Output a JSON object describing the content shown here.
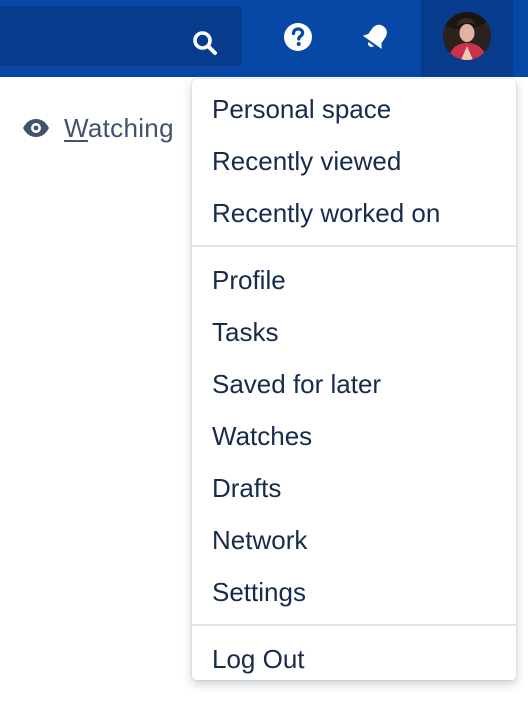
{
  "header": {
    "icons": {
      "search": "search-icon",
      "help": "help-icon",
      "notifications": "bell-icon",
      "avatar": "avatar"
    },
    "colors": {
      "bar": "#0747a6",
      "bar_dark": "#073b8c"
    }
  },
  "watching": {
    "icon": "eye-icon",
    "label_accesskey": "W",
    "label_rest": "atching"
  },
  "menu": {
    "sections": [
      {
        "items": [
          "Personal space",
          "Recently viewed",
          "Recently worked on"
        ]
      },
      {
        "items": [
          "Profile",
          "Tasks",
          "Saved for later",
          "Watches",
          "Drafts",
          "Network",
          "Settings"
        ]
      },
      {
        "items": [
          "Log Out"
        ]
      }
    ]
  }
}
